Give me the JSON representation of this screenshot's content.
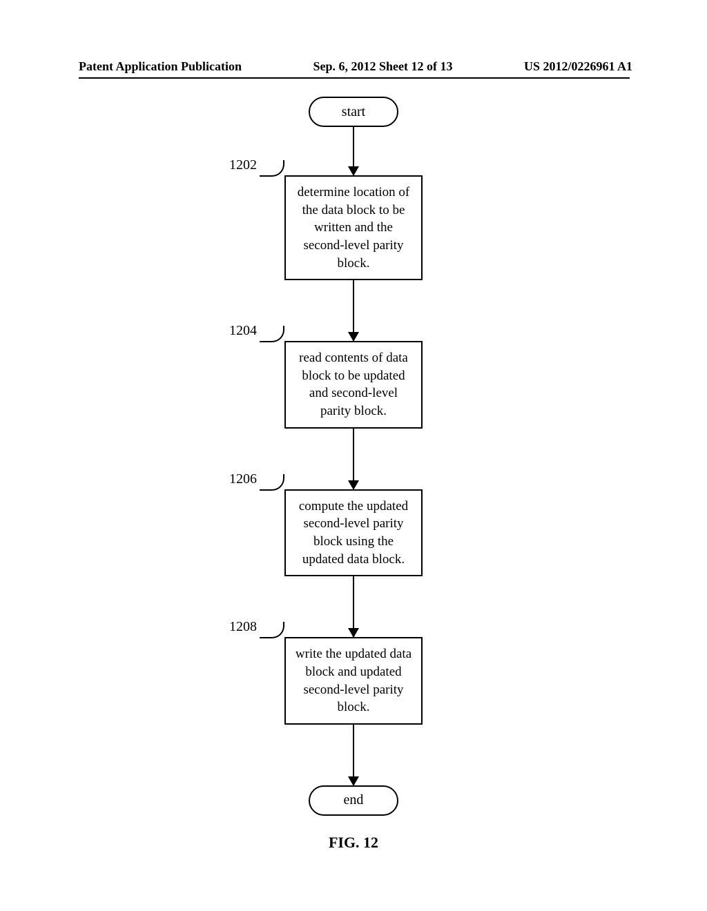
{
  "header": {
    "left": "Patent Application Publication",
    "center": "Sep. 6, 2012  Sheet 12 of 13",
    "right": "US 2012/0226961 A1"
  },
  "flowchart": {
    "start": "start",
    "end": "end",
    "caption": "FIG. 12",
    "steps": [
      {
        "ref": "1202",
        "text": "determine location of the data block to be written and the second-level parity block."
      },
      {
        "ref": "1204",
        "text": "read contents of data block to be updated and second-level parity block."
      },
      {
        "ref": "1206",
        "text": "compute the updated second-level parity block using the updated data block."
      },
      {
        "ref": "1208",
        "text": "write the updated data block and updated second-level parity block."
      }
    ]
  }
}
